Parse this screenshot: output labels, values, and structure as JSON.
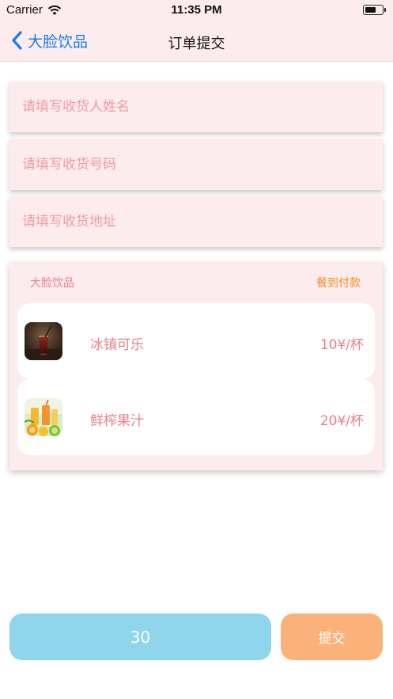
{
  "status_bar": {
    "carrier": "Carrier",
    "time": "11:35 PM",
    "wifi_icon": "wifi-icon",
    "battery_icon": "battery-icon"
  },
  "nav": {
    "back_label": "大脸饮品",
    "back_icon": "chevron-left-icon",
    "title": "订单提交",
    "back_color": "#1a7cf0"
  },
  "form": {
    "name_placeholder": "请填写收货人姓名",
    "phone_placeholder": "请填写收货号码",
    "address_placeholder": "请填写收货地址"
  },
  "order": {
    "shop_name": "大脸饮品",
    "payment_method": "餐到付款",
    "items": [
      {
        "name": "冰镇可乐",
        "price": "10¥/杯",
        "image": "cola-glass-image"
      },
      {
        "name": "鲜榨果汁",
        "price": "20¥/杯",
        "image": "fresh-juice-image"
      }
    ]
  },
  "footer": {
    "total": "30",
    "submit_label": "提交"
  },
  "colors": {
    "background_pink": "#fdeced",
    "text_pink": "#e8808a",
    "accent_orange": "#f08c22",
    "total_blue": "#8fd6ec",
    "submit_orange": "#fbb27a"
  }
}
